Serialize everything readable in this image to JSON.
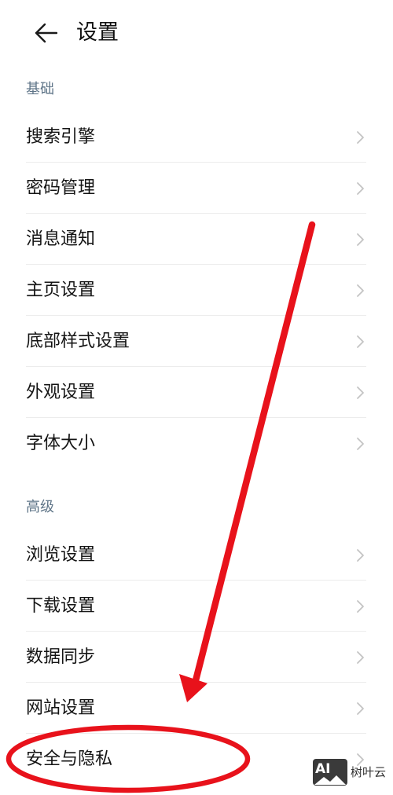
{
  "header": {
    "title": "设置",
    "back_icon": "arrow-left-icon"
  },
  "sections": [
    {
      "label": "基础",
      "items": [
        {
          "label": "搜索引擎"
        },
        {
          "label": "密码管理"
        },
        {
          "label": "消息通知"
        },
        {
          "label": "主页设置"
        },
        {
          "label": "底部样式设置"
        },
        {
          "label": "外观设置"
        },
        {
          "label": "字体大小"
        }
      ]
    },
    {
      "label": "高级",
      "items": [
        {
          "label": "浏览设置"
        },
        {
          "label": "下载设置"
        },
        {
          "label": "数据同步"
        },
        {
          "label": "网站设置"
        },
        {
          "label": "安全与隐私"
        }
      ]
    }
  ],
  "colors": {
    "section_label": "#5f7588",
    "chevron": "#c4c4c4",
    "annotation": "#e8121b"
  },
  "watermark": {
    "logo": "AI",
    "text": "树叶云"
  }
}
